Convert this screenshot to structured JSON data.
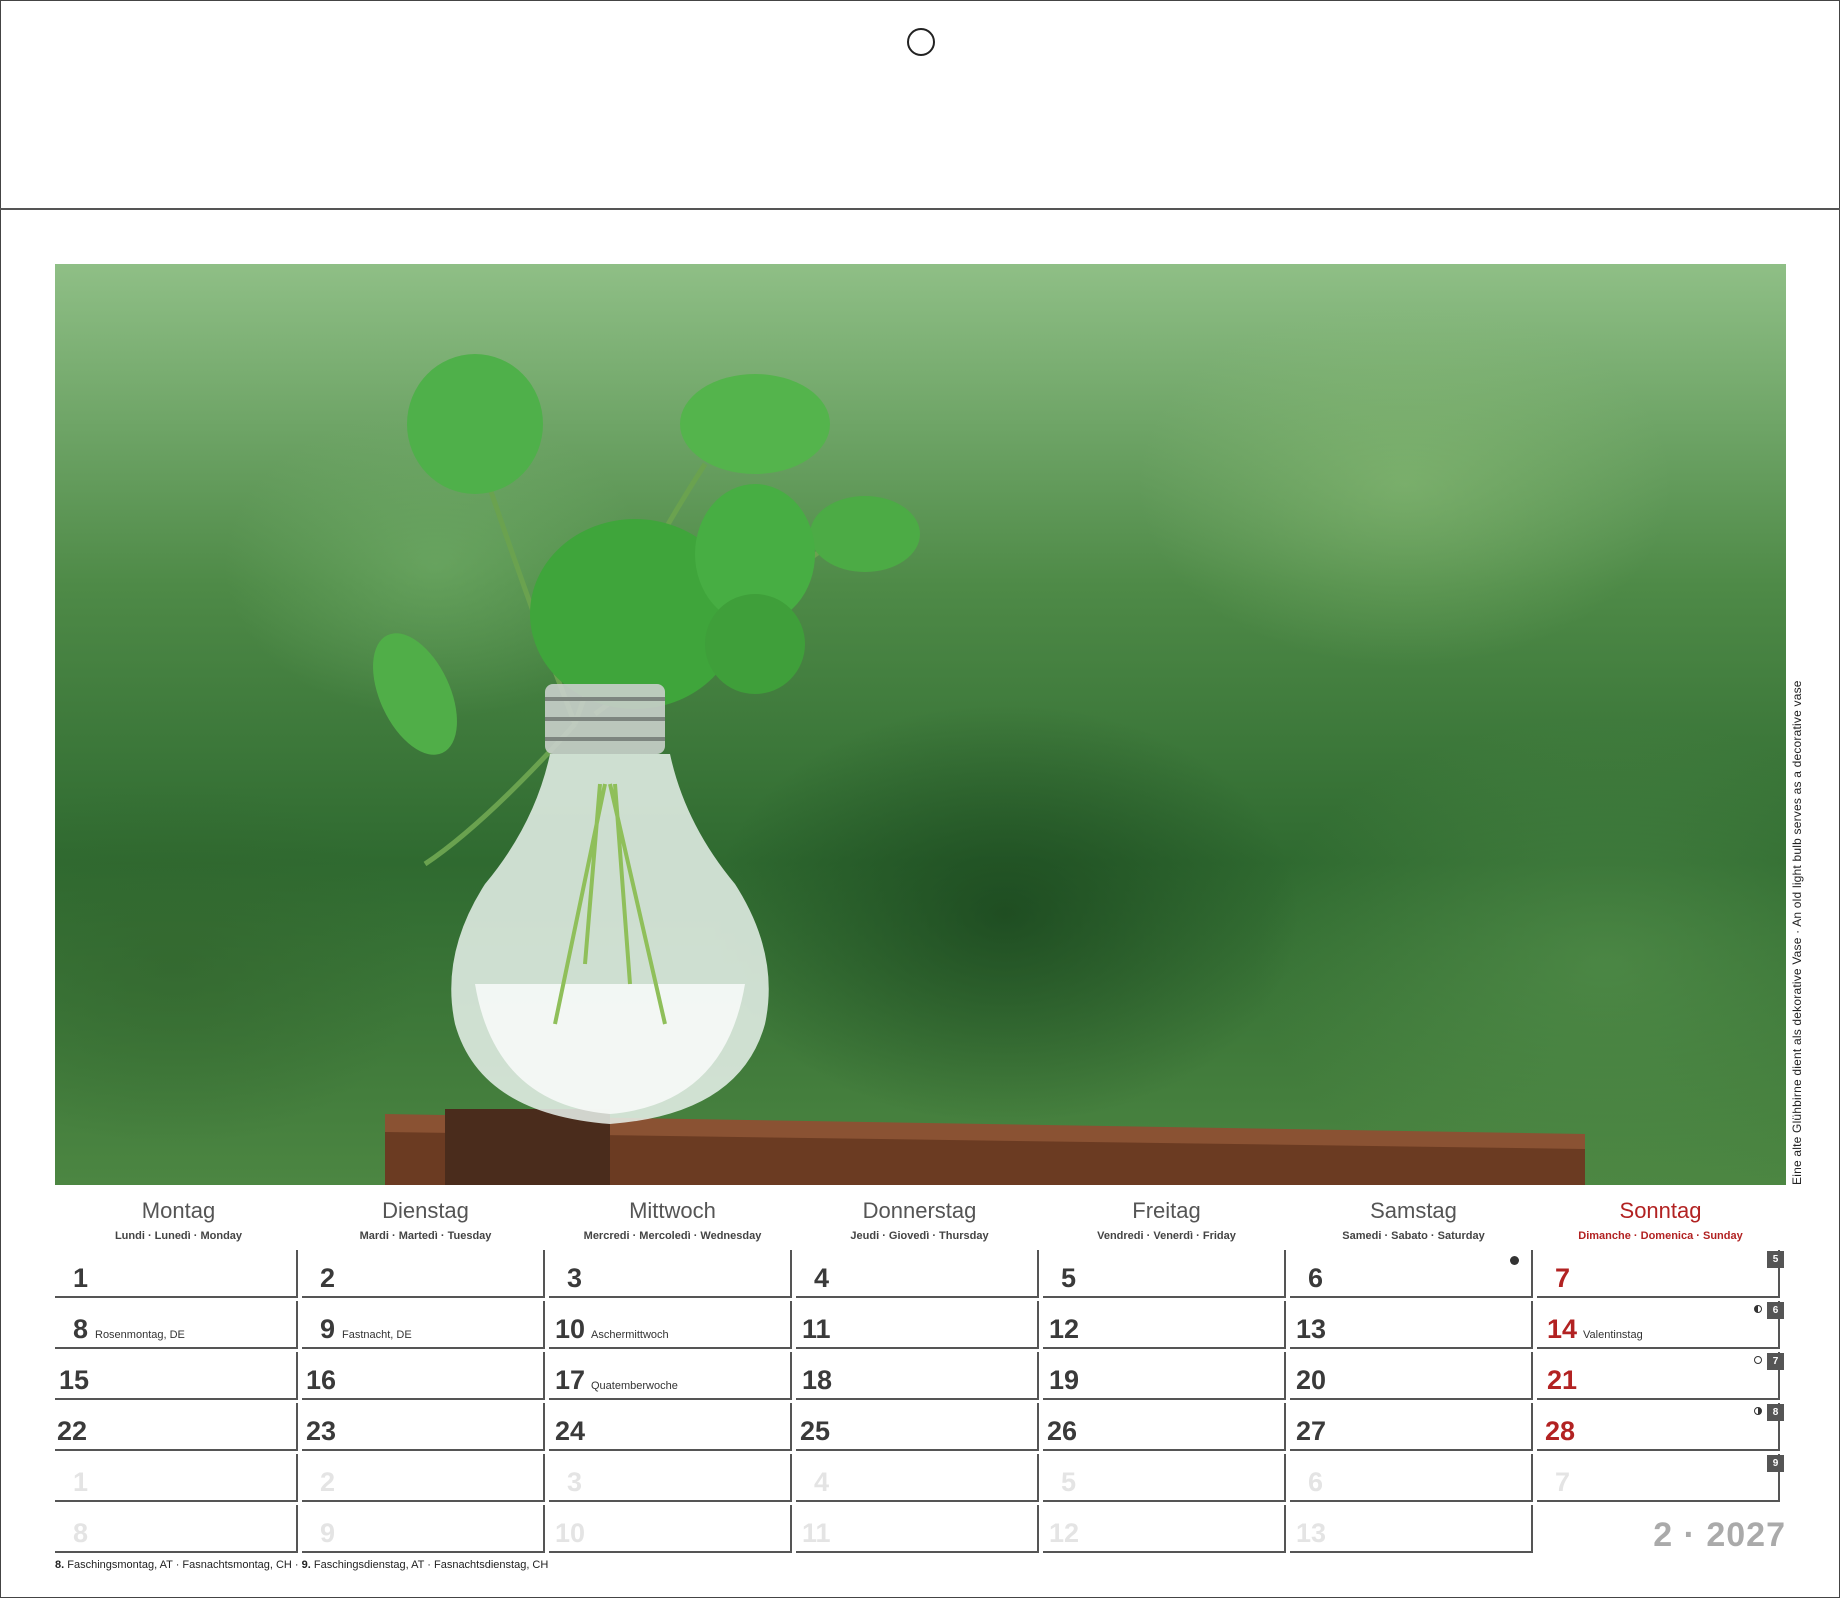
{
  "photo": {
    "caption": "Eine alte Glühbirne dient als dekorative Vase · An old light bulb serves as a decorative vase"
  },
  "weekdays": [
    {
      "name": "Montag",
      "sub": "Lundi · Lunedì · Monday"
    },
    {
      "name": "Dienstag",
      "sub": "Mardi · Martedì · Tuesday"
    },
    {
      "name": "Mittwoch",
      "sub": "Mercredi · Mercoledì · Wednesday"
    },
    {
      "name": "Donnerstag",
      "sub": "Jeudi · Giovedì · Thursday"
    },
    {
      "name": "Freitag",
      "sub": "Vendredi · Venerdì · Friday"
    },
    {
      "name": "Samstag",
      "sub": "Samedi · Sabato · Saturday"
    },
    {
      "name": "Sonntag",
      "sub": "Dimanche · Domenica · Sunday"
    }
  ],
  "weeks": [
    {
      "kw": "5",
      "days": [
        "1",
        "2",
        "3",
        "4",
        "5",
        "6",
        "7"
      ]
    },
    {
      "kw": "6",
      "days": [
        "8",
        "9",
        "10",
        "11",
        "12",
        "13",
        "14"
      ]
    },
    {
      "kw": "7",
      "days": [
        "15",
        "16",
        "17",
        "18",
        "19",
        "20",
        "21"
      ]
    },
    {
      "kw": "8",
      "days": [
        "22",
        "23",
        "24",
        "25",
        "26",
        "27",
        "28"
      ]
    },
    {
      "kw": "9",
      "days": [
        "1",
        "2",
        "3",
        "4",
        "5",
        "6",
        "7"
      ]
    },
    {
      "days": [
        "8",
        "9",
        "10",
        "11",
        "12",
        "13"
      ]
    }
  ],
  "holidays": {
    "d8": "Rosenmontag, DE",
    "d9": "Fastnacht, DE",
    "d10": "Aschermittwoch",
    "d14": "Valentinstag",
    "d17": "Quatemberwoche"
  },
  "month_year": "2 · 2027",
  "footnote": {
    "n1": "8.",
    "t1": "Faschingsmontag, AT",
    "t2": "Fasnachtsmontag, CH",
    "n2": "9.",
    "t3": "Faschingsdienstag, AT",
    "t4": "Fasnachtsdienstag, CH",
    "sep": "·"
  }
}
